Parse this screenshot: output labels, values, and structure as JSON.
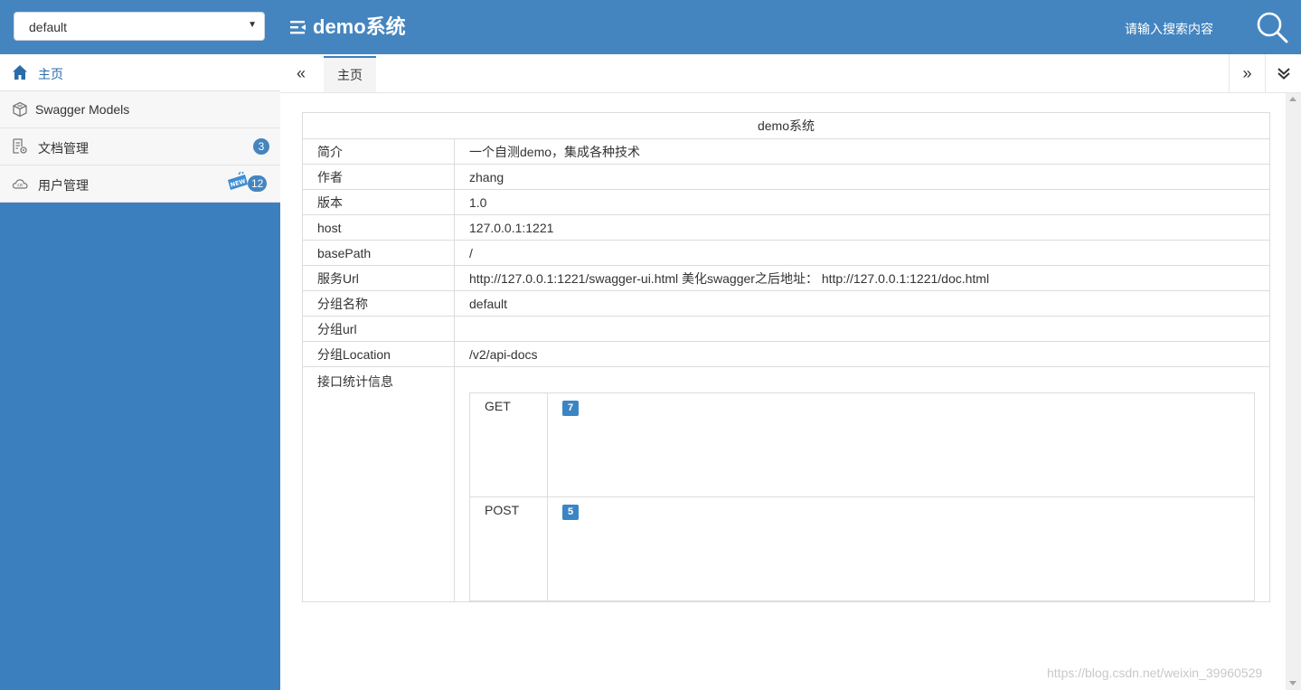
{
  "header": {
    "group_select": "default",
    "brand": "demo系统",
    "search_placeholder": "请输入搜索内容"
  },
  "sidebar": {
    "items": [
      {
        "label": "主页",
        "icon": "home-icon"
      },
      {
        "label": "Swagger Models",
        "icon": "cube-icon"
      },
      {
        "label": "文档管理",
        "icon": "doc-settings-icon",
        "count": "3"
      },
      {
        "label": "用户管理",
        "icon": "cloud-api-icon",
        "count": "12",
        "tag": "NEW"
      }
    ]
  },
  "tabs": {
    "home": "主页",
    "prev": "«",
    "next": "»"
  },
  "info": {
    "title": "demo系统",
    "rows": [
      {
        "key": "简介",
        "value": "一个自测demo，集成各种技术"
      },
      {
        "key": "作者",
        "value": "zhang"
      },
      {
        "key": "版本",
        "value": "1.0"
      },
      {
        "key": "host",
        "value": "127.0.0.1:1221"
      },
      {
        "key": "basePath",
        "value": "/"
      },
      {
        "key": "服务Url",
        "value": "http://127.0.0.1:1221/swagger-ui.html 美化swagger之后地址： http://127.0.0.1:1221/doc.html"
      },
      {
        "key": "分组名称",
        "value": "default"
      },
      {
        "key": "分组url",
        "value": ""
      },
      {
        "key": "分组Location",
        "value": "/v2/api-docs"
      }
    ],
    "stats_label": "接口统计信息",
    "stats": [
      {
        "method": "GET",
        "count": "7"
      },
      {
        "method": "POST",
        "count": "5"
      }
    ]
  },
  "watermark": "https://blog.csdn.net/weixin_39960529",
  "colors": {
    "header_bg": "#4585bf",
    "sidebar_bg": "#3c7fbf",
    "badge": "#3c85c4"
  }
}
